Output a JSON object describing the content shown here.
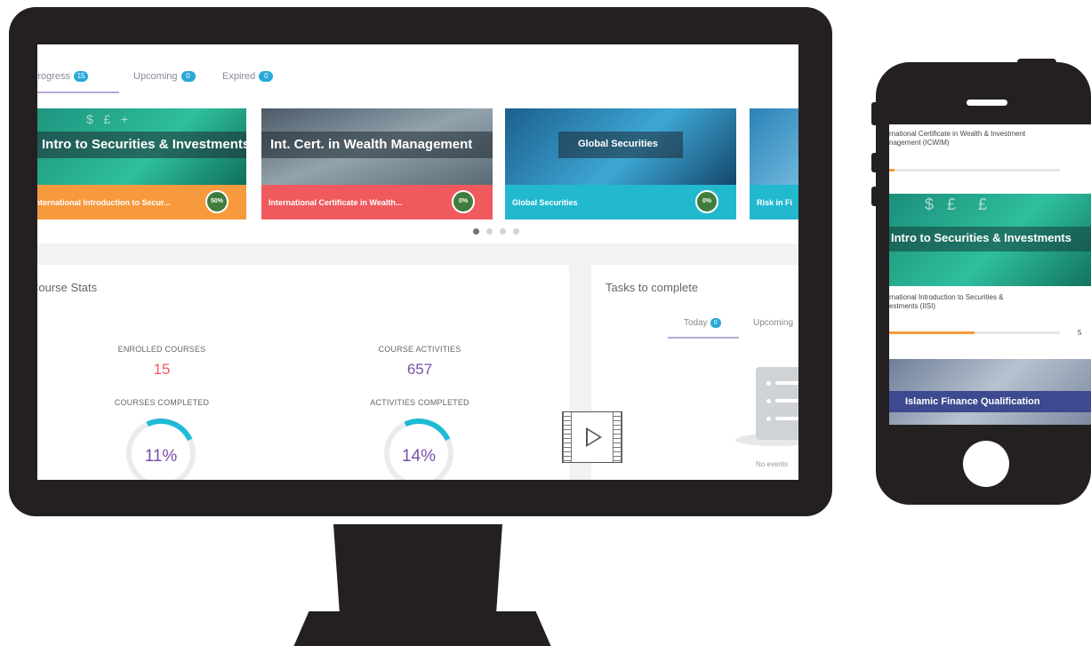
{
  "desktop": {
    "tabs": [
      {
        "label": "In progress",
        "count": "15"
      },
      {
        "label": "Upcoming",
        "count": "0"
      },
      {
        "label": "Expired",
        "count": "0"
      }
    ],
    "cards": [
      {
        "title": "Intro to Securities & Investments",
        "footer": "International Introduction to Secur...",
        "percent": "50%",
        "footer_color": "#f79a3e",
        "img_color": "#1d9e8a"
      },
      {
        "title": "Int. Cert. in Wealth Management",
        "footer": "International Certificate in Wealth...",
        "percent": "0%",
        "footer_color": "#ef5a5f",
        "img_color": "#6c7b86"
      },
      {
        "title": "Global Securities",
        "footer": "Global Securities",
        "percent": "0%",
        "footer_color": "#22b9cf",
        "img_color": "#2a7fb0"
      },
      {
        "title": "",
        "footer": "Risk in Fi",
        "percent": "",
        "footer_color": "#22b9cf",
        "img_color": "#3a8fc2"
      }
    ],
    "stats": {
      "title": "Course Stats",
      "enrolled_label": "ENROLLED COURSES",
      "enrolled_value": "15",
      "activities_label": "COURSE ACTIVITIES",
      "activities_value": "657",
      "completed_label": "COURSES COMPLETED",
      "completed_value": "11%",
      "completed_fraction": 0.11,
      "activities_completed_label": "ACTIVITIES COMPLETED",
      "activities_completed_value": "14%",
      "activities_completed_fraction": 0.14
    },
    "tasks": {
      "title": "Tasks to complete",
      "today_label": "Today",
      "today_count": "0",
      "upcoming_label": "Upcoming",
      "empty_text": "No events"
    }
  },
  "mobile": {
    "item1_title": "International Certificate in Wealth & Investment Management (ICWIM)",
    "item1_line1": "rnational Certificate in Wealth & Investment",
    "item1_line2": "nagement (ICWIM)",
    "card1_title": "Intro to Securities & Investments",
    "item2_line1": "rnational Introduction to Securities &",
    "item2_line2": "estments (IISI)",
    "item2_progress": 0.5,
    "item2_percent": "5",
    "card2_title": "Islamic Finance Qualification"
  },
  "colors": {
    "accent_purple": "#7a4fa8",
    "accent_teal": "#1fbad6",
    "enrolled_red": "#ef5a5f",
    "badge_blue": "#29a9d6",
    "device_black": "#242021"
  }
}
